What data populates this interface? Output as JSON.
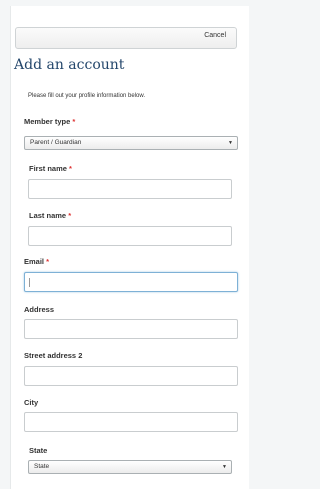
{
  "header": {
    "cancel_label": "Cancel"
  },
  "page_title": "Add an account",
  "intro_text": "Please fill out your profile information below.",
  "required_mark": "*",
  "fields": {
    "member_type": {
      "label": "Member type",
      "selected": "Parent / Guardian"
    },
    "first_name": {
      "label": "First name",
      "value": ""
    },
    "last_name": {
      "label": "Last name",
      "value": ""
    },
    "email": {
      "label": "Email",
      "value": ""
    },
    "address": {
      "label": "Address",
      "value": ""
    },
    "street_address_2": {
      "label": "Street address 2",
      "value": ""
    },
    "city": {
      "label": "City",
      "value": ""
    },
    "state": {
      "label": "State",
      "selected": "State"
    }
  },
  "colors": {
    "title": "#24476c",
    "required": "#dd3333",
    "focus_border": "#7eb1d6"
  }
}
